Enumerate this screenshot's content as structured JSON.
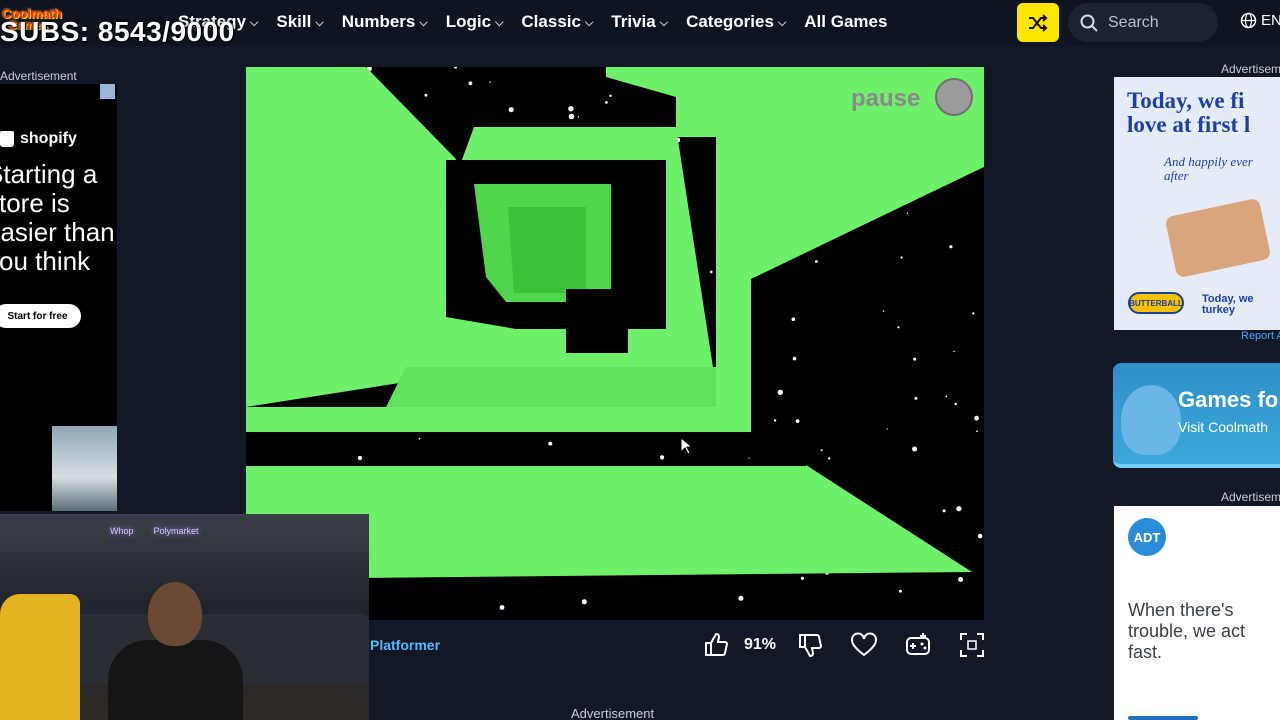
{
  "overlay": {
    "subs_counter": "SUBS: 8543/9000"
  },
  "logo": {
    "line1": "Coolmath",
    "line2": "Games"
  },
  "nav": {
    "items": [
      {
        "label": "Strategy",
        "has_menu": true
      },
      {
        "label": "Skill",
        "has_menu": true
      },
      {
        "label": "Numbers",
        "has_menu": true
      },
      {
        "label": "Logic",
        "has_menu": true
      },
      {
        "label": "Classic",
        "has_menu": true
      },
      {
        "label": "Trivia",
        "has_menu": true
      },
      {
        "label": "Categories",
        "has_menu": true
      },
      {
        "label": "All Games",
        "has_menu": false
      }
    ],
    "shuffle_icon": "shuffle-icon",
    "search_placeholder": "Search",
    "language": "EN"
  },
  "left_ad": {
    "label": "Advertisement",
    "brand": "shopify",
    "headline": "Starting a store is easier than you think",
    "cta": "Start for free"
  },
  "webcam": {
    "sign1": "Whop",
    "sign2": "Polymarket"
  },
  "game": {
    "pause_label": "pause",
    "accent_color": "#6ef06a",
    "background_color": "#000000",
    "category_link": "Platformer",
    "rating_percent": "91%"
  },
  "bottom_ad_label": "Advertisement",
  "right_ads": {
    "label1": "Advertisement",
    "butterball_headline_1": "Today, we fi",
    "butterball_headline_2": "love at first l",
    "butterball_script": "And happily ever after",
    "butterball_logo": "BUTTERBALL",
    "butterball_tag": "Today, we turkey",
    "report_link": "Report A",
    "promo_title": "Games fo",
    "promo_sub": "Visit Coolmath",
    "label2": "Advertisem",
    "adt_badge": "ADT",
    "adt_copy": "When there's trouble, we act fast."
  }
}
